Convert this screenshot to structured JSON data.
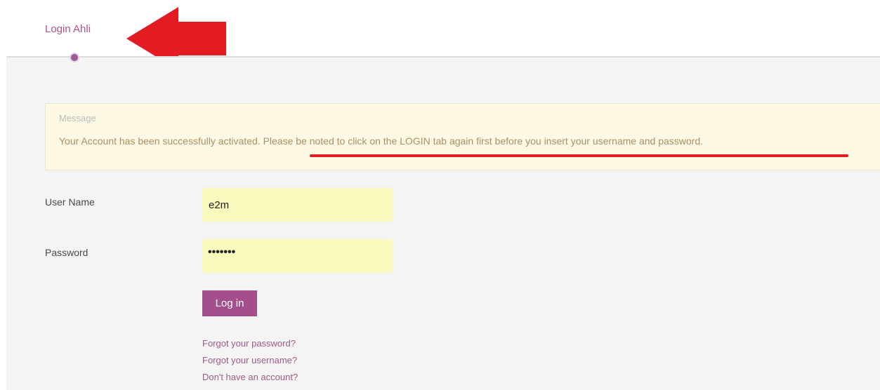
{
  "tabs": {
    "active_label": "Login Ahli"
  },
  "message": {
    "title": "Message",
    "text_part1": "Your Account has been successfully activated. ",
    "text_part2": "Please be noted to click on the LOGIN tab again first before you insert your username and password."
  },
  "form": {
    "username_label": "User Name",
    "username_value": "e2m",
    "password_label": "Password",
    "password_mask": "•••••••",
    "login_button": "Log in"
  },
  "links": {
    "forgot_password": "Forgot your password?",
    "forgot_username": "Forgot your username?",
    "no_account": "Don't have an account?"
  },
  "colors": {
    "accent": "#a34f8d",
    "annotation_red": "#e31b23",
    "message_bg": "#fcf8e3",
    "input_bg": "#fafabf"
  },
  "icons": {
    "annotation": "red-arrow-left-icon",
    "active_indicator": "tab-dot-icon"
  }
}
